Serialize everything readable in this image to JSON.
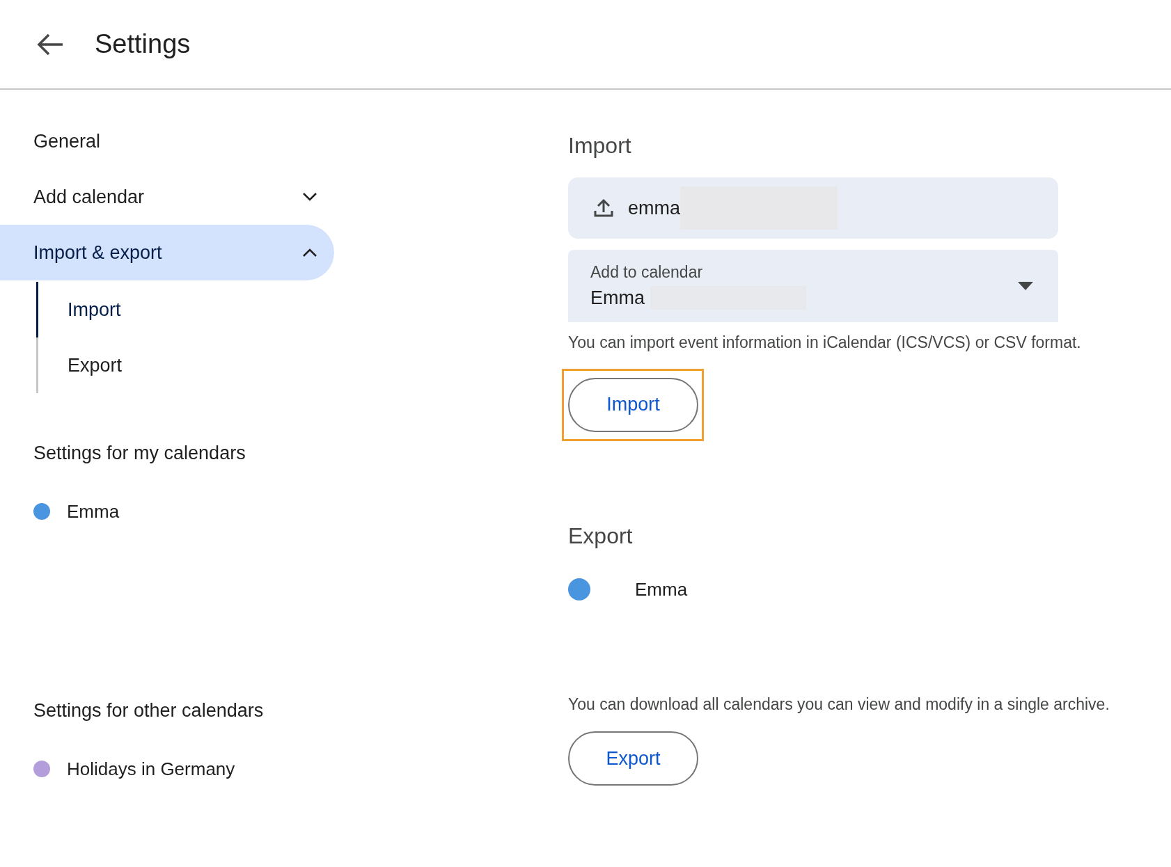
{
  "header": {
    "title": "Settings"
  },
  "sidebar": {
    "items": [
      {
        "label": "General",
        "selected": false
      },
      {
        "label": "Add calendar",
        "selected": false,
        "expanded": false
      },
      {
        "label": "Import & export",
        "selected": true,
        "expanded": true,
        "children": [
          {
            "label": "Import",
            "selected": true
          },
          {
            "label": "Export",
            "selected": false
          }
        ]
      }
    ],
    "sections": [
      {
        "title": "Settings for my calendars",
        "calendars": [
          {
            "name": "Emma",
            "color": "#4a95e0"
          }
        ]
      },
      {
        "title": "Settings for other calendars",
        "calendars": [
          {
            "name": "Holidays in Germany",
            "color": "#b39ddb"
          }
        ]
      }
    ]
  },
  "import": {
    "title": "Import",
    "file_field": {
      "value": "emma"
    },
    "calendar_select": {
      "label": "Add to calendar",
      "value": "Emma"
    },
    "note": "You can import event information in iCalendar (ICS/VCS) or CSV format.",
    "button": {
      "label": "Import",
      "highlighted": true
    }
  },
  "export": {
    "title": "Export",
    "calendars": [
      {
        "name": "Emma",
        "color": "#4a95e0"
      }
    ],
    "note": "You can download all calendars you can view and modify in a single archive.",
    "button": {
      "label": "Export",
      "highlighted": false
    }
  }
}
